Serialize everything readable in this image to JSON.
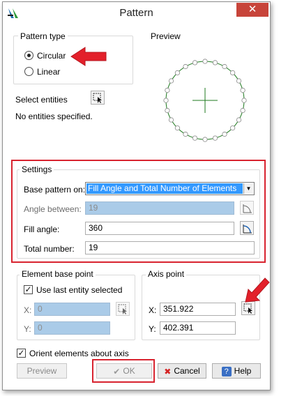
{
  "window": {
    "title": "Pattern",
    "close_glyph": "✕"
  },
  "pattern_type": {
    "legend": "Pattern type",
    "options": [
      {
        "label": "Circular",
        "selected": true
      },
      {
        "label": "Linear",
        "selected": false
      }
    ]
  },
  "preview": {
    "legend": "Preview",
    "circle_color": "#1e7a1e",
    "marker_count": 24
  },
  "select_entities": {
    "label": "Select entities",
    "status": "No entities specified."
  },
  "settings": {
    "legend": "Settings",
    "base_pattern_label": "Base pattern on:",
    "base_pattern_value": "Fill Angle and Total Number of Elements",
    "angle_between_label": "Angle between:",
    "angle_between_value": "19",
    "fill_angle_label": "Fill angle:",
    "fill_angle_value": "360",
    "total_number_label": "Total number:",
    "total_number_value": "19"
  },
  "element_base_point": {
    "legend": "Element base point",
    "use_last_label": "Use last entity selected",
    "use_last_checked": true,
    "x_label": "X:",
    "x_value": "0",
    "y_label": "Y:",
    "y_value": "0"
  },
  "axis_point": {
    "legend": "Axis point",
    "x_label": "X:",
    "x_value": "351.922",
    "y_label": "Y:",
    "y_value": "402.391"
  },
  "orient": {
    "label": "Orient elements about axis",
    "checked": true
  },
  "buttons": {
    "preview": "Preview",
    "ok": "OK",
    "cancel": "Cancel",
    "help": "Help"
  },
  "colors": {
    "highlight_red": "#d8232f",
    "disabled_field": "#aacbe8",
    "close_red": "#c7443a"
  }
}
